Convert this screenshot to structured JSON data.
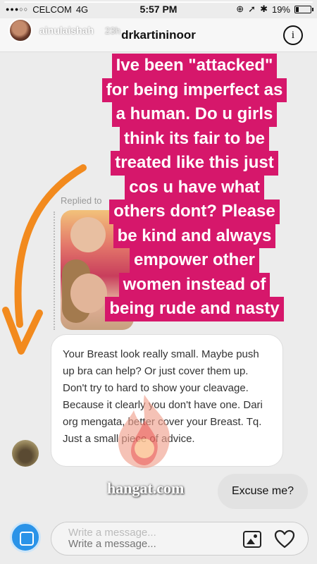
{
  "status_bar": {
    "carrier": "CELCOM",
    "network": "4G",
    "time": "5:57 PM",
    "battery": "19%",
    "battery_level": 0.19
  },
  "story": {
    "username": "ainulaishah",
    "time_ago": "23h"
  },
  "chat": {
    "title": "drkartininoor",
    "info_icon": "i",
    "replied_label": "Replied to"
  },
  "caption_lines": [
    "Ive been \"attacked\"",
    "for being imperfect as",
    "a human. Do u girls",
    "think its fair to be",
    "treated like this just",
    "cos u have what",
    "others dont? Please",
    "be kind and always",
    "empower other",
    "women instead of",
    "being rude and nasty"
  ],
  "incoming_message": "Your Breast look really small. Maybe push up bra can help? Or just cover them up. Don't try to hard to show your cleavage. Because it clearly you don't have one. Dari org mengata, better cover your Breast. Tq. Just a small piece of advice.",
  "outgoing_message": "Excuse me?",
  "watermark": "hangat.com",
  "compose": {
    "ghost_placeholder": "Write a message...",
    "placeholder": "Write a message..."
  },
  "colors": {
    "caption_bg": "#d6176b",
    "arrow": "#f28a1e",
    "camera": "#2a93e8"
  },
  "icons": [
    "camera-icon",
    "gallery-icon",
    "heart-icon",
    "info-icon",
    "wifi-icon",
    "bluetooth-icon",
    "battery-icon"
  ]
}
